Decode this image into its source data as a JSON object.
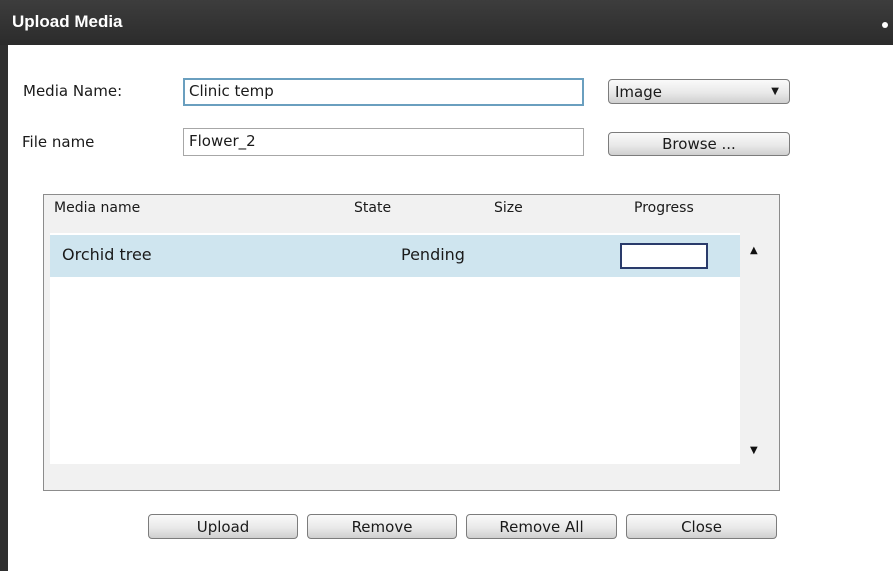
{
  "window": {
    "title": "Upload Media"
  },
  "form": {
    "media_name_label": "Media Name:",
    "media_name_value": "Clinic temp",
    "file_name_label": "File name",
    "file_name_value": "Flower_2",
    "media_type_selected": "Image",
    "browse_label": "Browse ..."
  },
  "list": {
    "columns": [
      "Media name",
      "State",
      "Size",
      "Progress"
    ],
    "rows": [
      {
        "name": "Orchid tree",
        "state": "Pending",
        "size": "",
        "progress": 0
      }
    ]
  },
  "actions": {
    "upload": "Upload",
    "remove": "Remove",
    "remove_all": "Remove All",
    "close": "Close"
  },
  "icons": {
    "dropdown": "chevron-down-icon",
    "scroll_up": "scroll-up-arrow-icon",
    "scroll_down": "scroll-down-arrow-icon"
  },
  "colors": {
    "titlebar": "#333333",
    "row_highlight": "#cfe5ef",
    "focus_border": "#6a9fbf",
    "progress_border": "#2a3b6b"
  }
}
